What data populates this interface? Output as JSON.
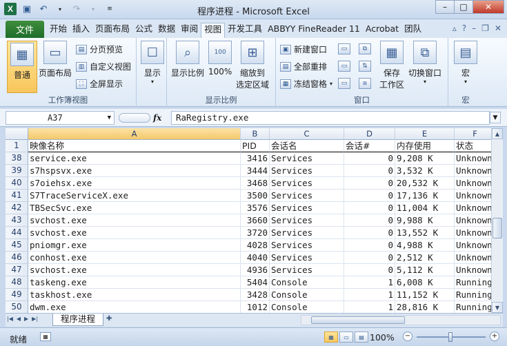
{
  "title": "程序进程 - Microsoft Excel",
  "window_buttons": {
    "minimize": "–",
    "maximize": "□",
    "close": "✕"
  },
  "ribbon_tabs": [
    "开始",
    "插入",
    "页面布局",
    "公式",
    "数据",
    "审阅",
    "视图",
    "开发工具",
    "ABBYY FineReader 11",
    "Acrobat",
    "团队"
  ],
  "active_tab": "视图",
  "file_tab": "文件",
  "ribbon": {
    "workbook_views": {
      "label": "工作簿视图",
      "normal": "普通",
      "page_layout": "页面布局",
      "page_break": "分页预览",
      "custom_views": "自定义视图",
      "full_screen": "全屏显示"
    },
    "show": {
      "label": "显示"
    },
    "zoom": {
      "label": "显示比例",
      "zoom": "显示比例",
      "hundred": "100%",
      "to_selection": [
        "缩放到",
        "选定区域"
      ]
    },
    "window": {
      "label": "窗口",
      "new_window": "新建窗口",
      "arrange_all": "全部重排",
      "freeze": "冻结窗格",
      "save_workspace": [
        "保存",
        "工作区"
      ],
      "switch_windows": "切换窗口"
    },
    "macros": {
      "label": "宏",
      "macros": "宏"
    }
  },
  "formula_bar": {
    "name_box": "A37",
    "fx": "fx",
    "formula": "RaRegistry.exe"
  },
  "columns": [
    "A",
    "B",
    "C",
    "D",
    "E",
    "F"
  ],
  "header_row": {
    "row_num": "1",
    "cells": [
      "映像名称",
      "PID",
      "会话名",
      "会话#",
      "内存使用",
      "状态"
    ]
  },
  "rows": [
    {
      "num": "38",
      "cells": [
        "service.exe",
        "3416",
        "Services",
        "0",
        "9,208 K",
        "Unknown"
      ]
    },
    {
      "num": "39",
      "cells": [
        "s7hspsvx.exe",
        "3444",
        "Services",
        "0",
        "3,532 K",
        "Unknown"
      ]
    },
    {
      "num": "40",
      "cells": [
        "s7oiehsx.exe",
        "3468",
        "Services",
        "0",
        "20,532 K",
        "Unknown"
      ]
    },
    {
      "num": "41",
      "cells": [
        "S7TraceServiceX.exe",
        "3500",
        "Services",
        "0",
        "17,136 K",
        "Unknown"
      ]
    },
    {
      "num": "42",
      "cells": [
        "TBSecSvc.exe",
        "3576",
        "Services",
        "0",
        "11,004 K",
        "Unknown"
      ]
    },
    {
      "num": "43",
      "cells": [
        "svchost.exe",
        "3660",
        "Services",
        "0",
        "9,988 K",
        "Unknown"
      ]
    },
    {
      "num": "44",
      "cells": [
        "svchost.exe",
        "3720",
        "Services",
        "0",
        "13,552 K",
        "Unknown"
      ]
    },
    {
      "num": "45",
      "cells": [
        "pniomgr.exe",
        "4028",
        "Services",
        "0",
        "4,988 K",
        "Unknown"
      ]
    },
    {
      "num": "46",
      "cells": [
        "conhost.exe",
        "4040",
        "Services",
        "0",
        "2,512 K",
        "Unknown"
      ]
    },
    {
      "num": "47",
      "cells": [
        "svchost.exe",
        "4936",
        "Services",
        "0",
        "5,112 K",
        "Unknown"
      ]
    },
    {
      "num": "48",
      "cells": [
        "taskeng.exe",
        "5404",
        "Console",
        "1",
        "6,008 K",
        "Running"
      ]
    },
    {
      "num": "49",
      "cells": [
        "taskhost.exe",
        "3428",
        "Console",
        "1",
        "11,152 K",
        "Running"
      ]
    },
    {
      "num": "50",
      "cells": [
        "dwm.exe",
        "1012",
        "Console",
        "1",
        "28,816 K",
        "Running"
      ]
    }
  ],
  "sheet_tab": "程序进程",
  "status": {
    "ready": "就绪",
    "zoom": "100%",
    "zoom_minus": "−",
    "zoom_plus": "+"
  }
}
